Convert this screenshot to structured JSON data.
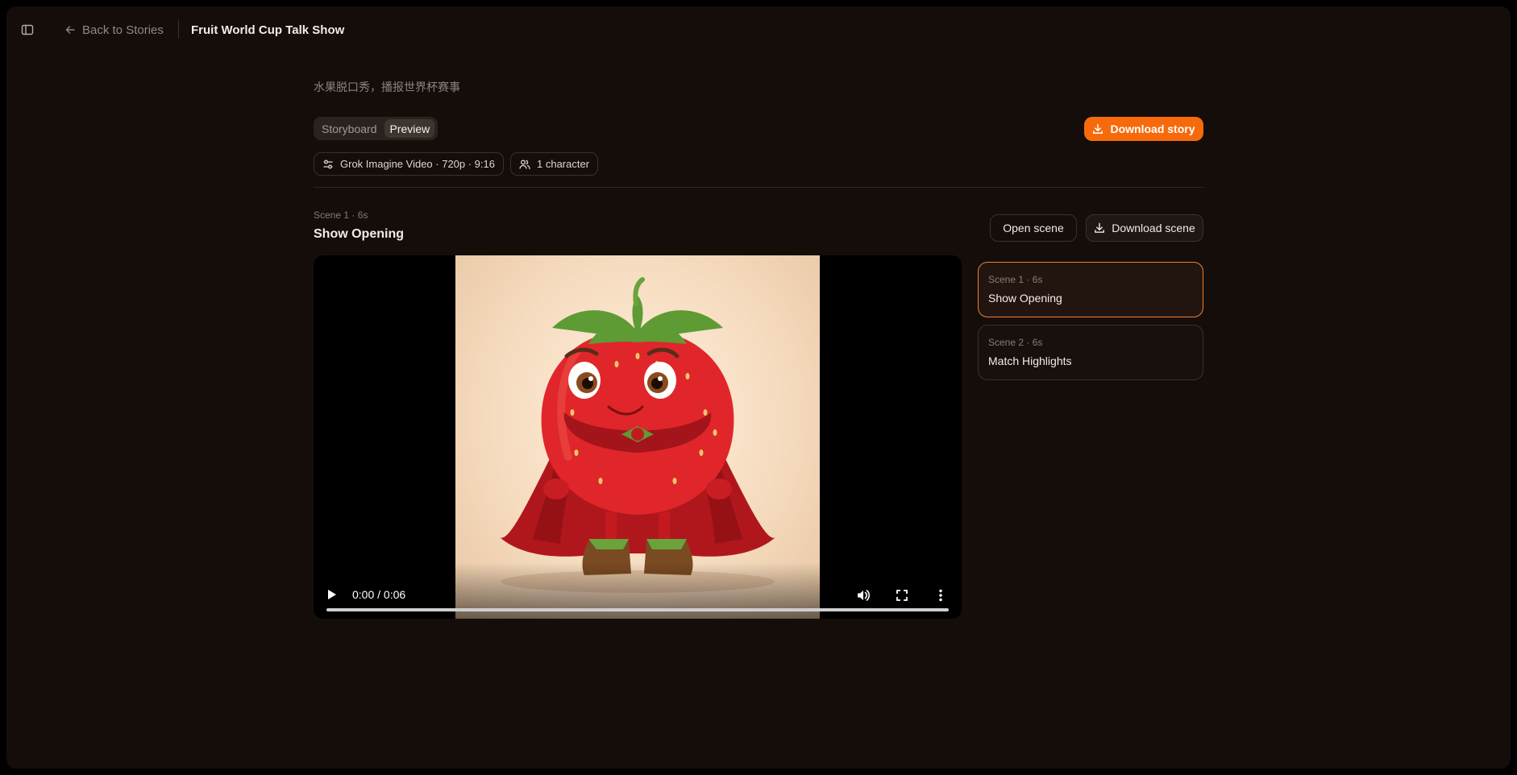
{
  "header": {
    "back_label": "Back to Stories",
    "title": "Fruit World Cup Talk Show"
  },
  "story": {
    "subtitle": "水果脱口秀，播报世界杯赛事",
    "tabs": [
      {
        "label": "Storyboard",
        "active": false
      },
      {
        "label": "Preview",
        "active": true
      }
    ],
    "download_label": "Download story",
    "chips": {
      "model": "Grok Imagine Video · 720p · 9:16",
      "characters": "1 character"
    }
  },
  "current_scene": {
    "meta": "Scene 1 · 6s",
    "title": "Show Opening",
    "open_label": "Open scene",
    "download_label": "Download scene"
  },
  "video": {
    "time": "0:00 / 0:06",
    "progress": 0
  },
  "scenes": [
    {
      "meta": "Scene 1 · 6s",
      "title": "Show Opening",
      "active": true
    },
    {
      "meta": "Scene 2 · 6s",
      "title": "Match Highlights",
      "active": false
    }
  ],
  "icons": {
    "sidebar": "sidebar-toggle-icon",
    "back": "arrow-left-icon",
    "download": "download-icon",
    "settings": "sliders-icon",
    "users": "users-icon",
    "play": "play-icon",
    "volume": "volume-icon",
    "fullscreen": "fullscreen-icon",
    "more": "more-vertical-icon"
  },
  "colors": {
    "accent": "#f66a0b",
    "background": "#140d0a",
    "active_border": "#f1802f"
  }
}
